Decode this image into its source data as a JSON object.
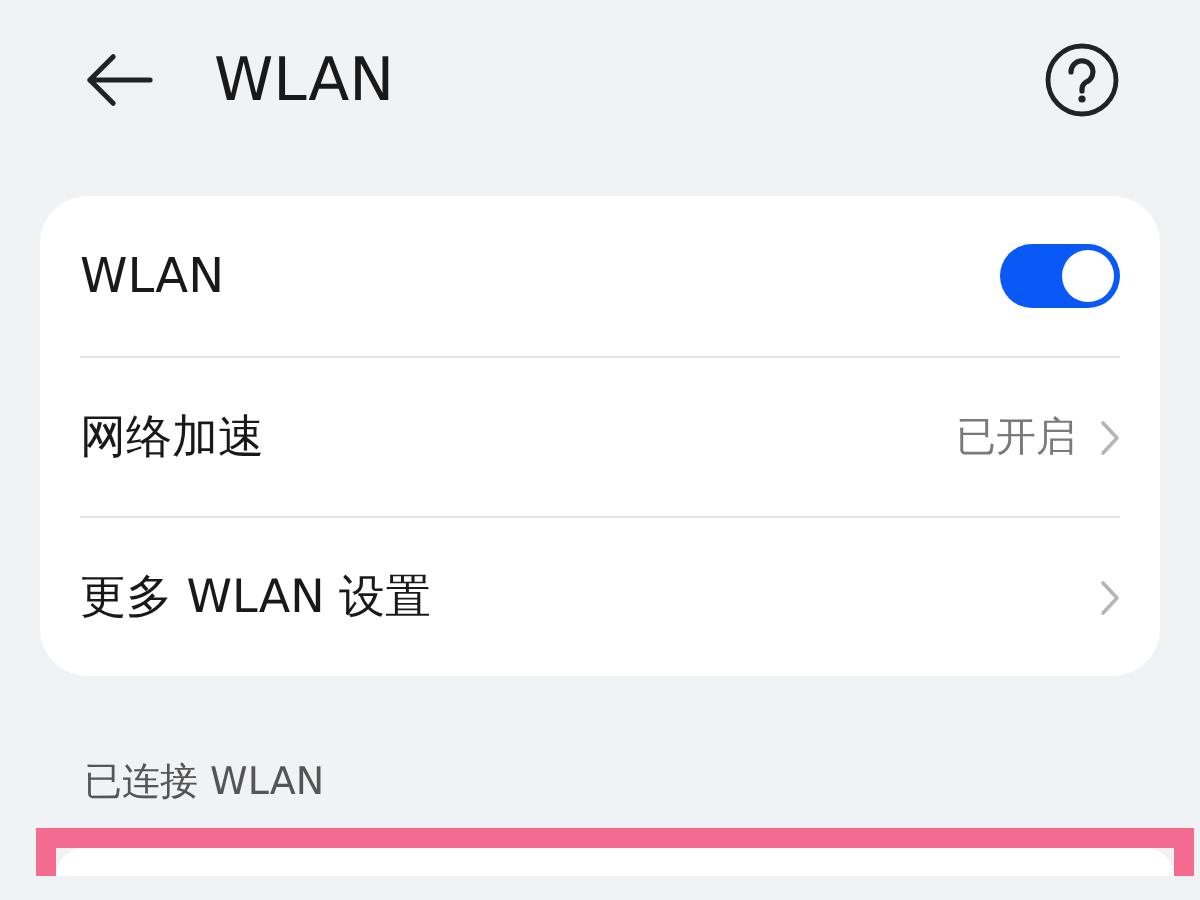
{
  "header": {
    "title": "WLAN"
  },
  "settings": [
    {
      "kind": "toggle",
      "label": "WLAN",
      "on": true
    },
    {
      "kind": "link",
      "label": "网络加速",
      "value": "已开启"
    },
    {
      "kind": "link",
      "label": "更多 WLAN 设置"
    }
  ],
  "connected_section": {
    "label": "已连接 WLAN",
    "highlighted": true
  }
}
